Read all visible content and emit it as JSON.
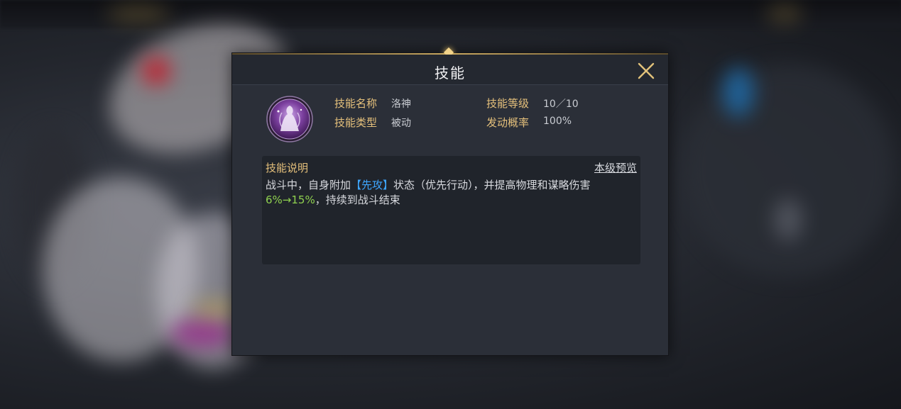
{
  "dialog": {
    "title": "技能",
    "close_icon": "close-icon"
  },
  "skill": {
    "icon": "goddess-skill-icon",
    "name_label": "技能名称",
    "name_value": "洛神",
    "type_label": "技能类型",
    "type_value": "被动",
    "level_label": "技能等级",
    "level_value": "10／10",
    "chance_label": "发动概率",
    "chance_value": "100%"
  },
  "description": {
    "title": "技能说明",
    "preview_link": "本级预览",
    "text_part1": "战斗中，自身附加",
    "keyword": "【先攻】",
    "text_part2": "状态（优先行动），并提高物理和谋略伤害",
    "value_range": "6%→15%",
    "text_part3": "，持续到战斗结束"
  },
  "colors": {
    "accent_gold": "#e5c07b",
    "keyword_blue": "#3ea6ff",
    "value_green": "#8fd14f",
    "icon_purple": "#7b3f9e"
  }
}
